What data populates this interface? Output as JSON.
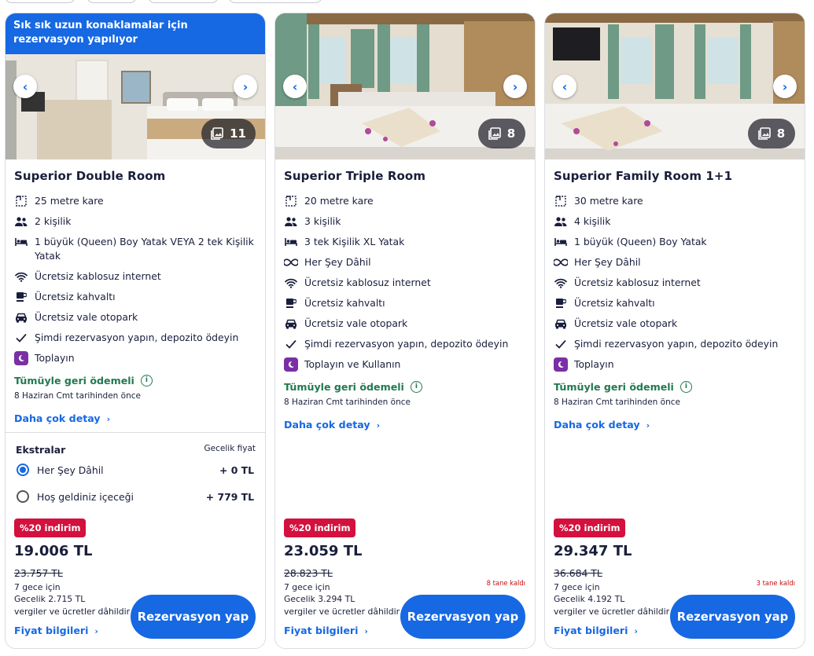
{
  "cards": [
    {
      "banner": "Sık sık uzun konaklamalar için rezervasyon yapılıyor",
      "photo_count": "11",
      "title": "Superior Double Room",
      "amenities": {
        "area": "25 metre kare",
        "guests": "2 kişilik",
        "beds": "1 büyük (Queen) Boy Yatak VEYA 2 tek Kişilik Yatak",
        "wifi": "Ücretsiz kablosuz internet",
        "breakfast": "Ücretsiz kahvaltı",
        "parking": "Ücretsiz vale otopark",
        "deposit": "Şimdi rezervasyon yapın, depozito ödeyin",
        "pay": "Toplayın"
      },
      "refund": "Tümüyle geri ödemeli",
      "refund_sub": "8 Haziran Cmt tarihinden önce",
      "details_link": "Daha çok detay",
      "extras": {
        "title": "Ekstralar",
        "header": "Gecelik fiyat",
        "options": [
          {
            "label": "Her Şey Dâhil",
            "price": "+ 0 TL",
            "selected": true
          },
          {
            "label": "Hoş geldiniz içeceği",
            "price": "+ 779 TL",
            "selected": false
          }
        ]
      },
      "discount": "%20 indirim",
      "price": "19.006 TL",
      "old_price": "23.757 TL",
      "nights": "7 gece için",
      "nightly": "Gecelik 2.715 TL",
      "taxes": "vergiler ve ücretler dâhildir",
      "price_info": "Fiyat bilgileri",
      "rooms_left": "",
      "reserve": "Rezervasyon yap"
    },
    {
      "photo_count": "8",
      "title": "Superior Triple Room",
      "amenities": {
        "area": "20 metre kare",
        "guests": "3 kişilik",
        "beds": "3 tek Kişilik XL Yatak",
        "all_inclusive": "Her Şey Dâhil",
        "wifi": "Ücretsiz kablosuz internet",
        "breakfast": "Ücretsiz kahvaltı",
        "parking": "Ücretsiz vale otopark",
        "deposit": "Şimdi rezervasyon yapın, depozito ödeyin",
        "pay": "Toplayın ve Kullanın"
      },
      "refund": "Tümüyle geri ödemeli",
      "refund_sub": "8 Haziran Cmt tarihinden önce",
      "details_link": "Daha çok detay",
      "discount": "%20 indirim",
      "price": "23.059 TL",
      "old_price": "28.823 TL",
      "nights": "7 gece için",
      "nightly": "Gecelik 3.294 TL",
      "taxes": "vergiler ve ücretler dâhildir",
      "price_info": "Fiyat bilgileri",
      "rooms_left": "8 tane kaldı",
      "reserve": "Rezervasyon yap"
    },
    {
      "photo_count": "8",
      "title": "Superior Family Room 1+1",
      "amenities": {
        "area": "30 metre kare",
        "guests": "4 kişilik",
        "beds": "1 büyük (Queen) Boy Yatak",
        "all_inclusive": "Her Şey Dâhil",
        "wifi": "Ücretsiz kablosuz internet",
        "breakfast": "Ücretsiz kahvaltı",
        "parking": "Ücretsiz vale otopark",
        "deposit": "Şimdi rezervasyon yapın, depozito ödeyin",
        "pay": "Toplayın"
      },
      "refund": "Tümüyle geri ödemeli",
      "refund_sub": "8 Haziran Cmt tarihinden önce",
      "details_link": "Daha çok detay",
      "discount": "%20 indirim",
      "price": "29.347 TL",
      "old_price": "36.684 TL",
      "nights": "7 gece için",
      "nightly": "Gecelik 4.192 TL",
      "taxes": "vergiler ve ücretler dâhildir",
      "price_info": "Fiyat bilgileri",
      "rooms_left": "3 tane kaldı",
      "reserve": "Rezervasyon yap"
    }
  ],
  "icons": {
    "area": "floor-plan-icon",
    "guests": "people-icon",
    "beds": "bed-icon",
    "all_inclusive": "infinity-icon",
    "wifi": "wifi-icon",
    "breakfast": "coffee-cup-icon",
    "parking": "car-icon",
    "deposit": "checkmark-icon",
    "pay": "moon-badge-icon",
    "gallery": "image-gallery-icon"
  },
  "colors": {
    "brand_blue": "#1668e3",
    "refund_green": "#227950",
    "discount_red": "#d3103e",
    "pay_badge_purple": "#7a2fa5"
  }
}
